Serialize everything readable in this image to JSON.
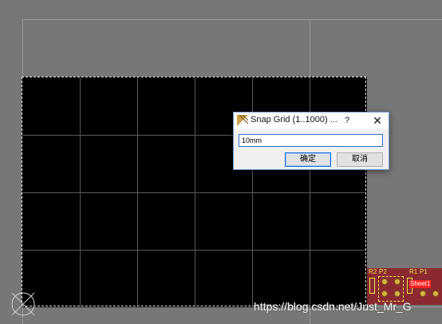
{
  "dialog": {
    "title": "Snap Grid (1..1000) ...",
    "help_label": "?",
    "close_label": "✕",
    "input_value": "10mm",
    "ok_label": "确定",
    "cancel_label": "取消"
  },
  "pcb": {
    "labels": [
      "R2",
      "P2",
      "R1",
      "P1"
    ],
    "sheet_badge": "Sheet1"
  },
  "watermark": "https://blog.csdn.net/Just_Mr_G",
  "icons": {
    "app": "pcb-app-icon",
    "origin": "origin-marker-icon"
  },
  "colors": {
    "workspace": "#777777",
    "board": "#000000",
    "focus_accent": "#2c6fd0"
  }
}
